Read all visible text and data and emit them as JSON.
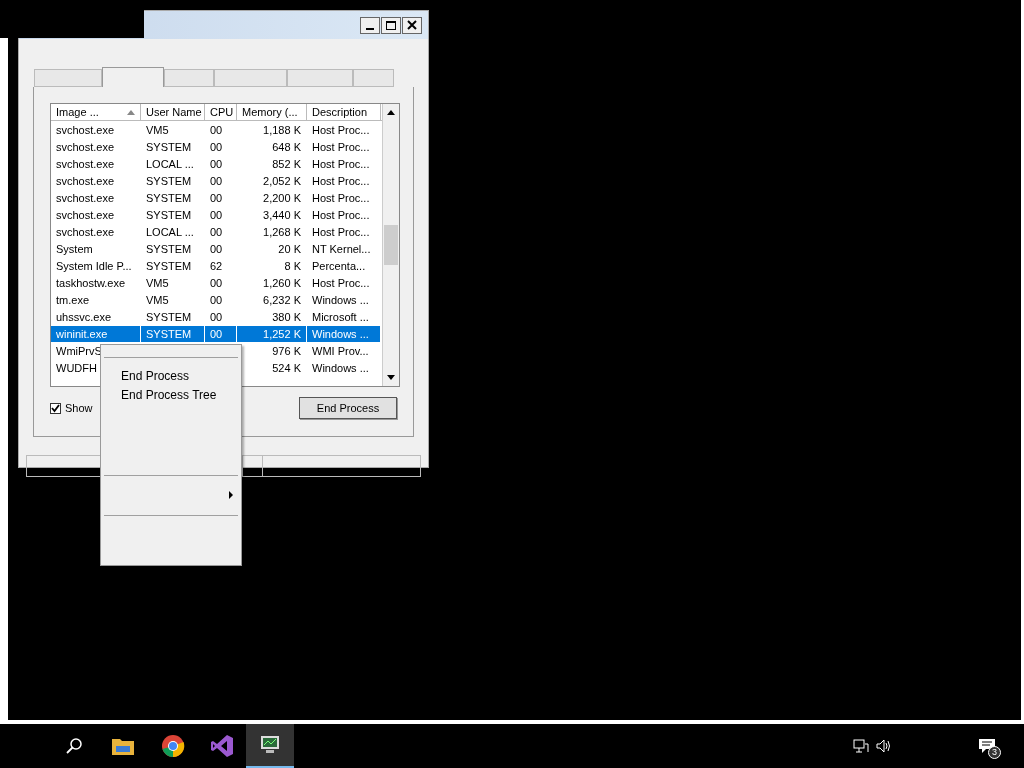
{
  "window": {
    "tabs": [
      {
        "selected": false
      },
      {
        "selected": true
      },
      {
        "selected": false
      },
      {
        "selected": false
      },
      {
        "selected": false
      },
      {
        "selected": false
      }
    ],
    "table": {
      "columns": [
        "Image ...",
        "User Name",
        "CPU",
        "Memory (...",
        "Description"
      ],
      "rows": [
        {
          "cells": [
            "svchost.exe",
            "VM5",
            "00",
            "1,188 K",
            "Host Proc..."
          ],
          "selected": false
        },
        {
          "cells": [
            "svchost.exe",
            "SYSTEM",
            "00",
            "648 K",
            "Host Proc..."
          ],
          "selected": false
        },
        {
          "cells": [
            "svchost.exe",
            "LOCAL ...",
            "00",
            "852 K",
            "Host Proc..."
          ],
          "selected": false
        },
        {
          "cells": [
            "svchost.exe",
            "SYSTEM",
            "00",
            "2,052 K",
            "Host Proc..."
          ],
          "selected": false
        },
        {
          "cells": [
            "svchost.exe",
            "SYSTEM",
            "00",
            "2,200 K",
            "Host Proc..."
          ],
          "selected": false
        },
        {
          "cells": [
            "svchost.exe",
            "SYSTEM",
            "00",
            "3,440 K",
            "Host Proc..."
          ],
          "selected": false
        },
        {
          "cells": [
            "svchost.exe",
            "LOCAL ...",
            "00",
            "1,268 K",
            "Host Proc..."
          ],
          "selected": false
        },
        {
          "cells": [
            "System",
            "SYSTEM",
            "00",
            "20 K",
            "NT Kernel..."
          ],
          "selected": false
        },
        {
          "cells": [
            "System Idle P...",
            "SYSTEM",
            "62",
            "8 K",
            "Percenta..."
          ],
          "selected": false
        },
        {
          "cells": [
            "taskhostw.exe",
            "VM5",
            "00",
            "1,260 K",
            "Host Proc..."
          ],
          "selected": false
        },
        {
          "cells": [
            "tm.exe",
            "VM5",
            "00",
            "6,232 K",
            "Windows ..."
          ],
          "selected": false
        },
        {
          "cells": [
            "uhssvc.exe",
            "SYSTEM",
            "00",
            "380 K",
            "Microsoft ..."
          ],
          "selected": false
        },
        {
          "cells": [
            "wininit.exe",
            "SYSTEM",
            "00",
            "1,252 K",
            "Windows ..."
          ],
          "selected": true
        },
        {
          "cells": [
            "WmiPrvS",
            "",
            "",
            "976 K",
            "WMI Prov..."
          ],
          "selected": false
        },
        {
          "cells": [
            "WUDFH",
            "",
            "",
            "524 K",
            "Windows ..."
          ],
          "selected": false
        }
      ]
    },
    "show_checkbox": {
      "label": "Show",
      "checked": true
    },
    "end_button": "End Process"
  },
  "context_menu": {
    "items": [
      {
        "kind": "separator"
      },
      {
        "kind": "item",
        "label": "End Process"
      },
      {
        "kind": "item",
        "label": "End Process Tree"
      },
      {
        "kind": "blank"
      },
      {
        "kind": "blank"
      },
      {
        "kind": "blank"
      },
      {
        "kind": "separator"
      },
      {
        "kind": "submenu"
      },
      {
        "kind": "separator"
      },
      {
        "kind": "blank"
      },
      {
        "kind": "blank"
      }
    ]
  },
  "taskbar": {
    "notification_count": "3"
  }
}
